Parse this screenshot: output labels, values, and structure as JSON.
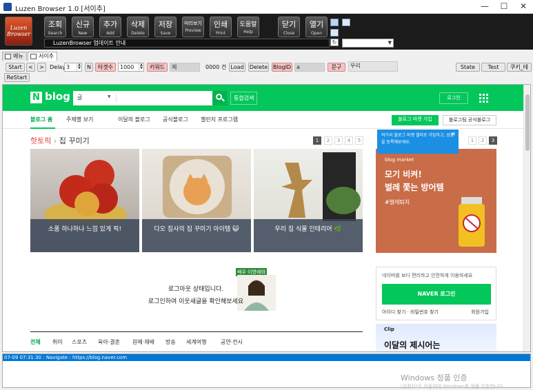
{
  "window": {
    "title": "Luzen Browser 1.0 [서이추]",
    "minimize": "—",
    "maximize": "☐",
    "close": "✕"
  },
  "toolbar": {
    "logo_line1": "Luzen",
    "logo_line2": "Browser",
    "buttons": [
      {
        "ko": "조회",
        "en": "Search"
      },
      {
        "ko": "신규",
        "en": "New"
      },
      {
        "ko": "추가",
        "en": "Add"
      },
      {
        "ko": "삭제",
        "en": "Delete"
      },
      {
        "ko": "저장",
        "en": "Save"
      },
      {
        "ko": "미리보기",
        "en": "Preview"
      },
      {
        "ko": "인쇄",
        "en": "Print"
      },
      {
        "ko": "도움말",
        "en": "Help"
      },
      {
        "ko": "닫기",
        "en": "Close"
      },
      {
        "ko": "열기",
        "en": "Open"
      }
    ],
    "notice": "LuzenBrowser 업데이트 안내"
  },
  "tabs": [
    {
      "label": "메뉴"
    },
    {
      "label": "서이추"
    }
  ],
  "controls": {
    "start": "Start",
    "prev": "<",
    "next": ">",
    "delay_label": "Delay",
    "delay_value": "3",
    "n_label": "N",
    "count_label": "타겟수",
    "count_value": "1000",
    "keyword_label": "키워드",
    "keyword_value": "제",
    "result": "0000 건",
    "load": "Load",
    "delete": "Delete",
    "blogid": "BlogID",
    "blogid_value": "a",
    "phrase_label": "문구",
    "phrase_value": "우리",
    "state": "State",
    "test": "Test",
    "cookie": "쿠키_테",
    "restart": "ReStart"
  },
  "page": {
    "brand": "blog",
    "search_category": "글",
    "integrated_search": "통합검색",
    "login": "로그인",
    "nav": [
      "블로그 홈",
      "주제별 보기",
      "이달의 블로그",
      "공식블로그",
      "챌린지 프로그램"
    ],
    "market_join": "블로그 마켓 가입",
    "official": "블로그팀 공식블로그",
    "hot_topic": "핫토픽",
    "hot_sub": "집 꾸미기",
    "pager_left": [
      "1",
      "2",
      "3",
      "4",
      "5"
    ],
    "pager_right": [
      "1",
      "2",
      "3"
    ],
    "cards": [
      {
        "caption": "소품 하나하나 느낌 있게 픽!"
      },
      {
        "caption": "다오 집사의 집 꾸미기 아이템 😺"
      },
      {
        "caption": "우리 집 식물 인테리어 🌿"
      }
    ],
    "tip": "여기서 블로그 마켓 셀러로 가입하고, 상품을 등록해보세요.",
    "ad": {
      "sub": "blog market",
      "line1": "모기 비켜!",
      "line2": "벌레 쫓는 방어템",
      "tag": "#벌레퇴치"
    },
    "actor_tag": "배우 이영애와",
    "logout_line1": "로그아웃 상태입니다.",
    "logout_line2": "로그인하여 이웃새글을 확인해보세요",
    "categories": [
      "전체",
      "취미",
      "스포츠",
      "육아·결혼",
      "원예·재배",
      "방송",
      "세계여행",
      "공연·전시"
    ],
    "login_box": {
      "text": "네이버를 보다 편리하고 안전하게 이용하세요",
      "button": "NAVER 로그인",
      "links": "아이디 찾기 · 비밀번호 찾기",
      "join": "회원가입"
    },
    "clip": {
      "title": "Clip",
      "headline": "이달의 제시어는"
    }
  },
  "log": {
    "line": "07-09 07:31:30 : Navigate : https://blog.naver.com"
  },
  "watermark": {
    "line1": "Windows 정품 인증",
    "line2": "[설정]으로 이동하여 Windows를 정품 인증합니다."
  }
}
